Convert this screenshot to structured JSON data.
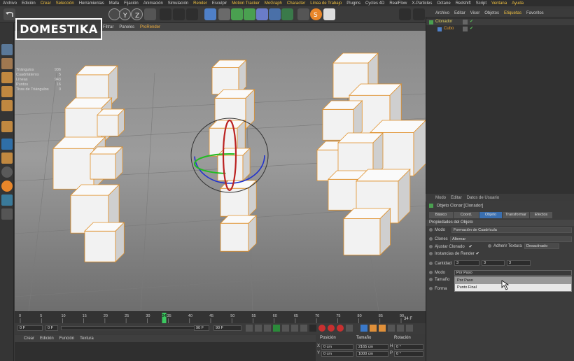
{
  "menubar": {
    "items": [
      "Archivo",
      "Edición",
      "Crear",
      "Selección",
      "Herramientas",
      "Malla",
      "Fijación",
      "Animación",
      "Simulación",
      "Render",
      "Esculpir",
      "Motion Tracker",
      "MoGraph",
      "Character",
      "Línea de Trabajo",
      "Plugins",
      "Cycles 4D",
      "RealFlow",
      "X-Particles",
      "Octane",
      "Redshift",
      "Script",
      "Ventana",
      "Ayuda"
    ],
    "highlighted": [
      2,
      3,
      9,
      11,
      12,
      13,
      14,
      22,
      23
    ]
  },
  "logo": {
    "text": "DOMESTIKA"
  },
  "viewport_menu": {
    "items": [
      "Filtrar",
      "Paneles",
      "ProRender"
    ]
  },
  "stats": {
    "rows": [
      {
        "label": "Triángulos",
        "value": "936"
      },
      {
        "label": "Cuadriláteros",
        "value": "5"
      },
      {
        "label": "Líneas",
        "value": "943"
      },
      {
        "label": "Puntos",
        "value": "16"
      },
      {
        "label": "Tiras de Triángulos",
        "value": "0"
      }
    ]
  },
  "timeline": {
    "ticks": [
      "0",
      "5",
      "10",
      "15",
      "20",
      "25",
      "30",
      "35",
      "40",
      "45",
      "50",
      "55",
      "60",
      "65",
      "70",
      "75",
      "80",
      "85",
      "90"
    ],
    "current_frame": "34",
    "end_label": "34 F"
  },
  "transport": {
    "start_frame": "0 F",
    "range_start": "0 F",
    "range_end": "90 F",
    "end_frame": "90 F"
  },
  "material_menu": {
    "items": [
      "Crear",
      "Edición",
      "Función",
      "Textura"
    ]
  },
  "coords": {
    "headers": [
      "Posición",
      "Tamaño",
      "Rotación"
    ],
    "rows": [
      {
        "axis": "X",
        "pos": "0 cm",
        "size": "2165 cm",
        "rot_axis": "H",
        "rot": "0 °"
      },
      {
        "axis": "Y",
        "pos": "0 cm",
        "size": "1000 cm",
        "rot_axis": "P",
        "rot": "0 °"
      }
    ]
  },
  "object_menu": {
    "items": [
      "Archivo",
      "Editar",
      "Visor",
      "Objetos",
      "Etiquetas",
      "Favoritos"
    ],
    "active": 4
  },
  "objects": [
    {
      "name": "Clonador",
      "color": "#e0d060"
    },
    {
      "name": "Cubo",
      "color": "#e8a030"
    }
  ],
  "attr_menu": {
    "items": [
      "Modo",
      "Editar",
      "Datos de Usuario"
    ]
  },
  "attributes": {
    "object_title": "Objeto Clonar [Clonador]",
    "tabs": [
      "Básico",
      "Coord.",
      "Objeto",
      "Transformar",
      "Efectos"
    ],
    "active_tab": 2,
    "section": "Propiedades del Objeto",
    "mode_label": "Modo",
    "mode_value": "Formación de Cuadrícula",
    "clones_label": "Clones",
    "clones_value": "Alternar",
    "fix_clone_label": "Ajustar Clonado",
    "fix_texture_label": "Adherir Textura",
    "fix_texture_value": "Desactivado",
    "render_instances_label": "Instancias de Render",
    "count_label": "Cantidad",
    "count_values": [
      "3",
      "3",
      "3"
    ],
    "mode2_label": "Modo",
    "mode2_value": "Por Paso",
    "size_label": "Tamaño",
    "dropdown_options": [
      "Por Paso",
      "Punto Final"
    ],
    "shape_label": "Forma"
  }
}
